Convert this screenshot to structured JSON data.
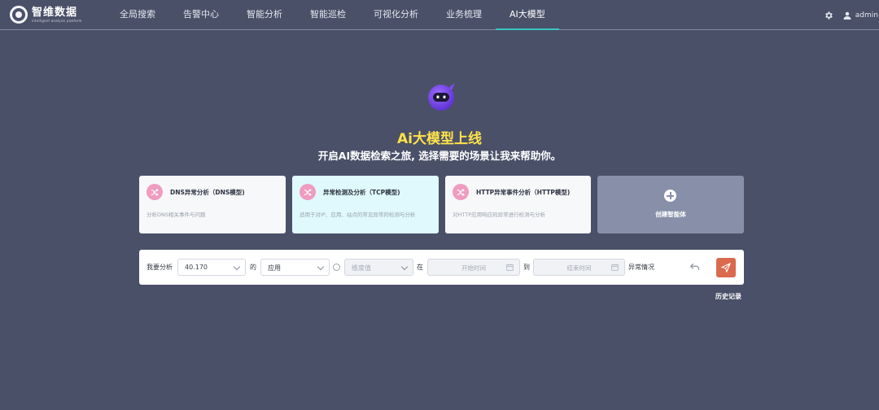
{
  "brand": {
    "name": "智维数据",
    "subtitle": "intelligent analysis platform"
  },
  "nav": {
    "items": [
      {
        "label": "全局搜索"
      },
      {
        "label": "告警中心"
      },
      {
        "label": "智能分析"
      },
      {
        "label": "智能巡检"
      },
      {
        "label": "可视化分析"
      },
      {
        "label": "业务梳理"
      },
      {
        "label": "AI大模型"
      }
    ],
    "active_index": 6,
    "active_color": "#39c5c2"
  },
  "header_right": {
    "settings_icon": "gear-icon",
    "user_icon": "user-icon",
    "username": "admin"
  },
  "hero": {
    "icon": "robot-icon",
    "title": "Ai大模型上线",
    "subtitle": "开启AI数据检索之旅, 选择需要的场景让我来帮助你。",
    "title_color": "#ffe24a"
  },
  "cards": [
    {
      "title": "DNS异常分析（DNS模型)",
      "desc": "分析DNS相关事件与问题",
      "icon": "shuffle-icon"
    },
    {
      "title": "异常检测及分析（TCP模型)",
      "desc": "适用于对IP、应用、站点的常见异常的检测与分析",
      "icon": "shuffle-icon"
    },
    {
      "title": "HTTP异常事件分析（HTTP模型)",
      "desc": "对HTTP应用响应码异常进行检测与分析",
      "icon": "shuffle-icon"
    },
    {
      "title": "创建智能体",
      "icon": "plus-circle-icon"
    }
  ],
  "query": {
    "prefix": "我要分析",
    "target": {
      "value": "40.170"
    },
    "of_label": "的",
    "type": {
      "value": "应用"
    },
    "dimension": {
      "placeholder": "维度值"
    },
    "at_label": "在",
    "start": {
      "placeholder": "开始时间"
    },
    "to_label": "到",
    "end": {
      "placeholder": "结束时间"
    },
    "suffix": "异常情况",
    "send_color": "#d96a4e"
  },
  "history_label": "历史记录"
}
